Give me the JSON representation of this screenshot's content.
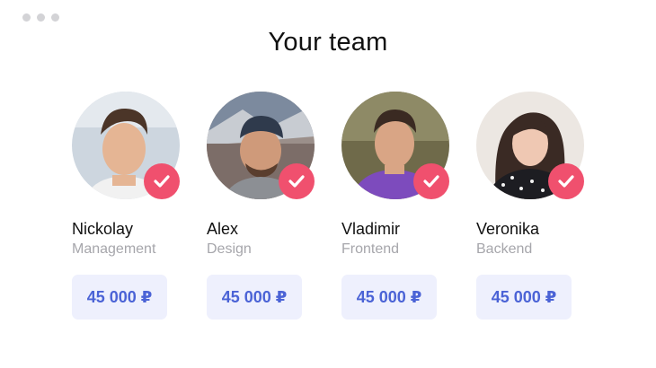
{
  "window": {
    "controls": [
      "dot",
      "dot",
      "dot"
    ]
  },
  "page": {
    "title": "Your team"
  },
  "colors": {
    "accent_check": "#f0506e",
    "price_text": "#4b63d6",
    "price_bg": "#eef0fd",
    "role_text": "#a6a6ab"
  },
  "team": [
    {
      "name": "Nickolay",
      "role": "Management",
      "price": "45 000 ₽",
      "selected": true,
      "icon": "check-icon"
    },
    {
      "name": "Alex",
      "role": "Design",
      "price": "45 000 ₽",
      "selected": true,
      "icon": "check-icon"
    },
    {
      "name": "Vladimir",
      "role": "Frontend",
      "price": "45 000 ₽",
      "selected": true,
      "icon": "check-icon"
    },
    {
      "name": "Veronika",
      "role": "Backend",
      "price": "45 000 ₽",
      "selected": true,
      "icon": "check-icon"
    }
  ]
}
